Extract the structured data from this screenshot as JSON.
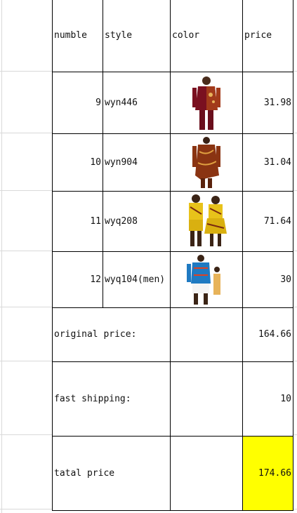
{
  "table": {
    "headers": {
      "numble": "numble",
      "style": "style",
      "color": "color",
      "price": "price"
    },
    "rows": [
      {
        "num": "9",
        "style": "wyn446",
        "price": "31.98",
        "image": "maroon-print-shirt-man-photo"
      },
      {
        "num": "10",
        "style": "wyn904",
        "price": "31.04",
        "image": "brown-print-long-shirt-man-photo"
      },
      {
        "num": "11",
        "style": "wyq208",
        "price": "71.64",
        "image": "yellow-print-couple-outfit-photo"
      },
      {
        "num": "12",
        "style": "wyq104(men)",
        "price": "30",
        "image": "blue-print-shirt-couple-photo"
      }
    ],
    "summary": {
      "original_label": "original price:",
      "original_value": "164.66",
      "shipping_label": "fast shipping:",
      "shipping_value": "10",
      "total_label": "tatal price",
      "total_value": "174.66"
    }
  },
  "colors": {
    "highlight": "#ffff00",
    "border": "#000000",
    "gridline": "#d9d9d9"
  }
}
